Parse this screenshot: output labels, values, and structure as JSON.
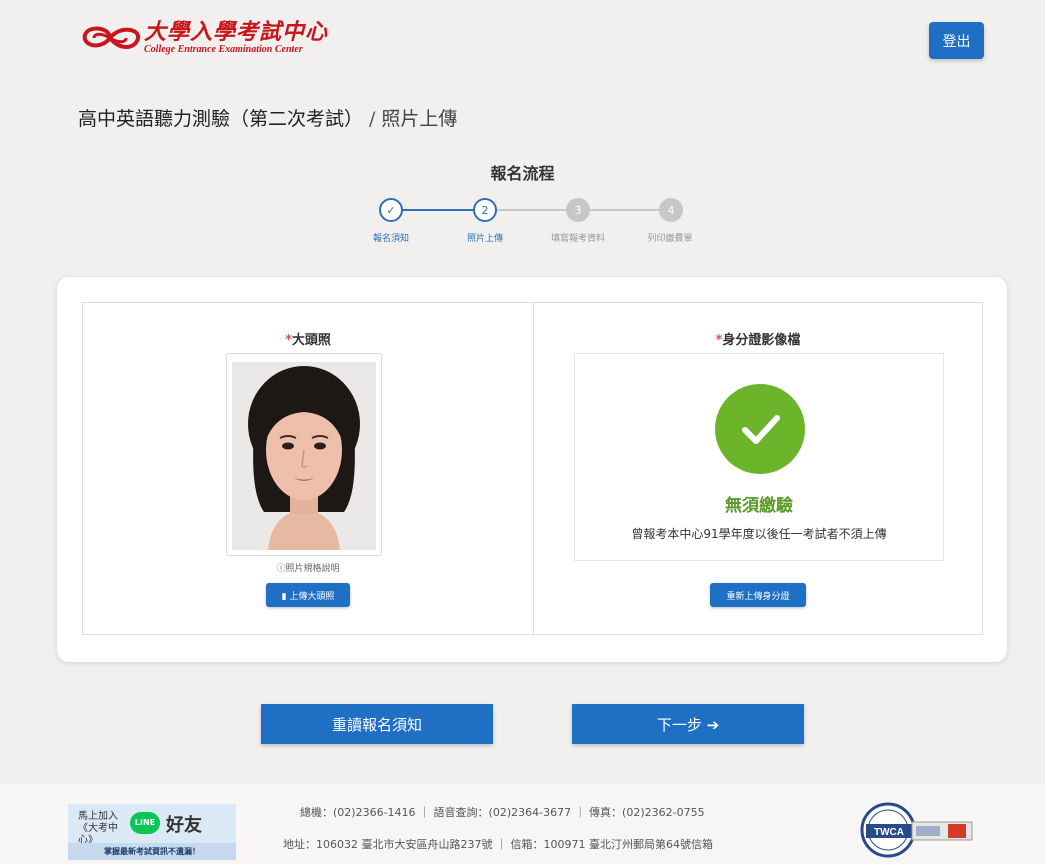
{
  "header": {
    "logo_zh": "大學入學考試中心",
    "logo_en": "College Entrance Examination Center",
    "logout_label": "登出"
  },
  "page": {
    "title": "高中英語聽力測驗（第二次考試）",
    "separator": "/",
    "subtitle": "照片上傳"
  },
  "steps": {
    "title": "報名流程",
    "items": [
      {
        "num": "✓",
        "label": "報名須知",
        "state": "done"
      },
      {
        "num": "2",
        "label": "照片上傳",
        "state": "current"
      },
      {
        "num": "3",
        "label": "填寫報考資料",
        "state": "todo"
      },
      {
        "num": "4",
        "label": "列印繳費單",
        "state": "todo"
      }
    ]
  },
  "photo_panel": {
    "required_mark": "*",
    "title": "大頭照",
    "note": "ⓘ照片規格說明",
    "upload_label": "上傳大頭照"
  },
  "id_panel": {
    "required_mark": "*",
    "title": "身分證影像檔",
    "exempt_title": "無須繳驗",
    "exempt_desc": "曾報考本中心91學年度以後任一考試者不須上傳",
    "reupload_label": "重新上傳身分證"
  },
  "actions": {
    "reread_label": "重讀報名須知",
    "next_label": "下一步 ➔"
  },
  "footer": {
    "line_join": "馬上加入《大考中心》",
    "line_badge": "LINE",
    "line_friend": "好友",
    "line_slogan": "掌握最新考試資訊不遺漏！",
    "contact": "總機：(02)2366-1416 ｜ 語音查詢：(02)2364-3677 ｜ 傳真：(02)2362-0755",
    "address": "地址：106032 臺北市大安區舟山路237號 ｜ 信箱：100971 臺北汀州郵局第64號信箱",
    "twca_label": "TWCA"
  },
  "colors": {
    "primary": "#1f6fc5",
    "brand_red": "#c8161d",
    "success": "#6cb52b",
    "step_inactive": "#c7c7c7"
  }
}
